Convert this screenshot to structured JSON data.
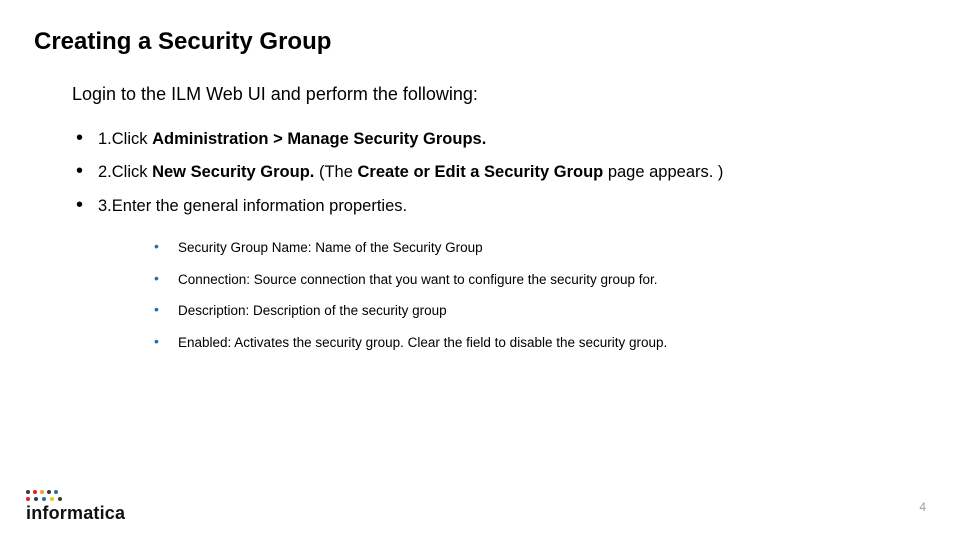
{
  "title": "Creating a Security Group",
  "intro": "Login to the ILM Web UI and perform the following:",
  "steps": {
    "s1": {
      "prefix": "1.Click ",
      "bold": "Administration > Manage Security Groups."
    },
    "s2": {
      "prefix": "2.Click ",
      "bold1": "New Security Group.",
      "mid": " (The ",
      "bold2": "Create or Edit a Security Group",
      "suffix": " page appears. )"
    },
    "s3": {
      "text": "3.Enter the general information properties."
    }
  },
  "properties": [
    "Security Group Name: Name of the Security Group",
    "Connection: Source connection that you want to configure the security group for.",
    "Description: Description of the security group",
    "Enabled: Activates the security group. Clear the field to disable the security group."
  ],
  "page_number": "4",
  "logo": {
    "wordmark": "informatica",
    "dot_colors_row1": [
      "#3a3a3a",
      "#e41e26",
      "#f9a11b",
      "#3a3a3a",
      "#1f6fb2"
    ],
    "dot_colors_row2": [
      "#e41e26",
      "#3a3a3a",
      "#1f6fb2",
      "#f2c500",
      "#3a3a3a"
    ]
  }
}
